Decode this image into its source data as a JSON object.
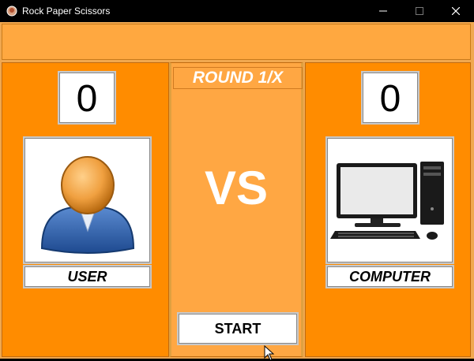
{
  "window": {
    "title": "Rock Paper Scissors"
  },
  "user": {
    "score": "0",
    "label": "USER"
  },
  "computer": {
    "score": "0",
    "label": "COMPUTER"
  },
  "round": {
    "text": "ROUND 1/X"
  },
  "center": {
    "vs": "VS"
  },
  "controls": {
    "start_label": "START"
  },
  "colors": {
    "panel": "#ff8c00",
    "middle": "#ffa743",
    "topbar": "#ffa840"
  },
  "icons": [
    "app-icon",
    "minimize-icon",
    "maximize-icon",
    "close-icon",
    "user-avatar-icon",
    "computer-icon",
    "mouse-cursor-icon"
  ]
}
